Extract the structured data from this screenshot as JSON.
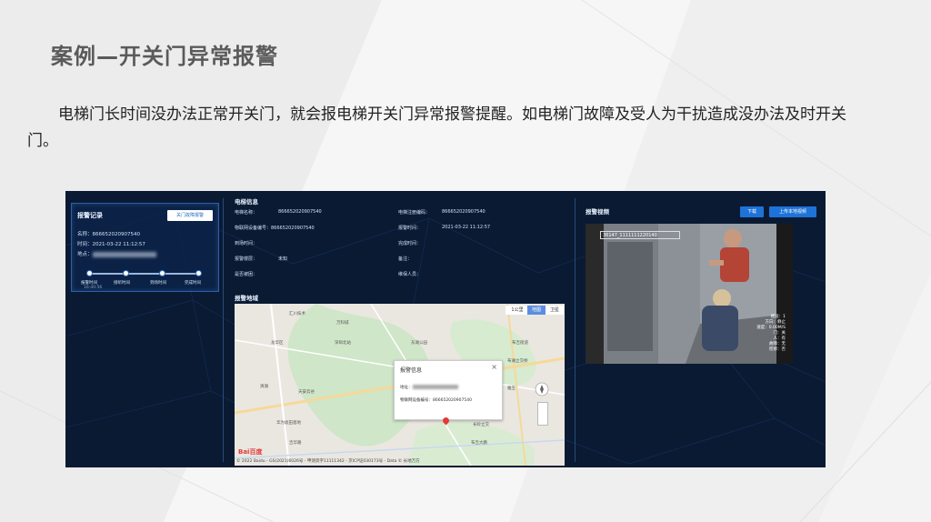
{
  "slide": {
    "title": "案例—开关门异常报警",
    "body": "电梯门长时间没办法正常开关门，就会报电梯开关门异常报警提醒。如电梯门故障及受人为干扰造成没办法及时开关门。"
  },
  "alarm_card": {
    "title": "报警记录",
    "button": "关门故障报警",
    "name_line": "名称：866652020907540",
    "time_line": "时间：2021-03-22  11:12:57",
    "location_label": "地点：",
    "timeline_steps": [
      "报警时间",
      "接听时间",
      "到场时间",
      "完成时间"
    ],
    "timeline_time": "16:40:56"
  },
  "elevator_info": {
    "title": "电梯信息",
    "fields": [
      "电梯名称：",
      "866652020907540",
      "电梯注册编码：",
      "866652020907540",
      "物联网设备编号：866652020907540",
      "报警时间：",
      "2021-03-22  11:12:57",
      "到场时间：",
      "完成时间：",
      "报警楼层：",
      "未知",
      "备注：",
      "是否被困：",
      "维保人员："
    ]
  },
  "map": {
    "title": "报警地域",
    "scale": "1公里",
    "ctrl_map": "地图",
    "ctrl_sat": "卫星",
    "labels": [
      "汇川技术",
      "万科城",
      "龙华区",
      "清湖",
      "天安云谷",
      "华为坂田基地",
      "东湖公园",
      "布吉街道",
      "布澜立交桥",
      "长岭立交",
      "布吉大鹏",
      "吉华路",
      "深圳北站",
      "雅宝"
    ],
    "popup": {
      "title": "报警信息",
      "close": "×",
      "address_label": "地址：",
      "device_line": "物联网设备编号：866652020907540"
    },
    "logo": "Bai百度",
    "footer": "© 2022 Baidu - GS(2021)6026号 - 甲测资字11111342 - 京ICP证030173号 - Data © 长地万方"
  },
  "video": {
    "title": "报警视频",
    "download": "下载",
    "upload": "上传本地视频",
    "timestamp": "36147_1111111220140",
    "osd": [
      "楼层：1",
      "方向：静止",
      "速度：0.00M/S",
      "门：关",
      "人：有",
      "",
      "故障：无",
      "",
      "检修：否"
    ]
  },
  "colors": {
    "panel_bg": "#0a1a33",
    "accent": "#1e73d8",
    "alarm_pin": "#e23a3a"
  }
}
